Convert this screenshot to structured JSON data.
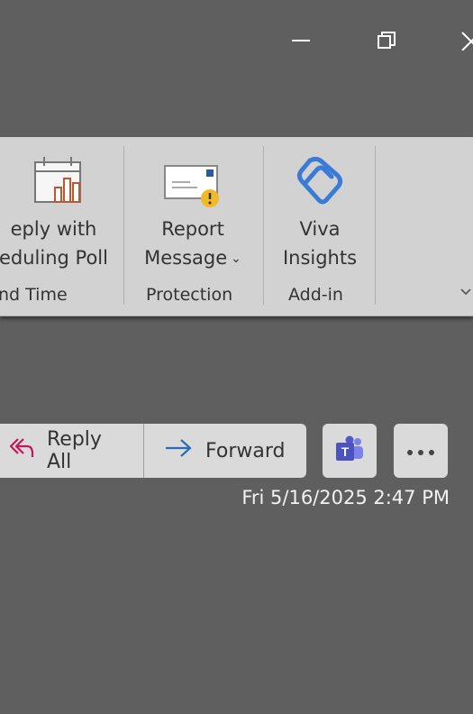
{
  "window": {
    "minimize_icon": "minimize-icon",
    "restore_icon": "restore-icon",
    "close_icon": "close-icon"
  },
  "ribbon": {
    "groups": [
      {
        "label": "nd Time",
        "buttons": [
          {
            "line1": "eply with",
            "line2": "eduling Poll",
            "icon": "scheduling-poll-icon"
          }
        ]
      },
      {
        "label": "Protection",
        "buttons": [
          {
            "line1": "Report",
            "line2": "Message",
            "has_dropdown": true,
            "icon": "report-message-icon"
          }
        ]
      },
      {
        "label": "Add-in",
        "buttons": [
          {
            "line1": "Viva",
            "line2": "Insights",
            "icon": "viva-insights-icon"
          }
        ]
      }
    ],
    "expand_icon": "chevron-down-icon"
  },
  "actions": {
    "reply_all": "Reply All",
    "forward": "Forward",
    "teams_icon": "teams-icon",
    "more_icon": "more-icon"
  },
  "message": {
    "timestamp": "Fri 5/16/2025 2:47 PM"
  },
  "colors": {
    "background": "#5f5f5f",
    "ribbon": "#d2d2d2",
    "button": "#dadada",
    "reply_all_accent": "#c2185b",
    "forward_accent": "#2a6bb7",
    "viva_accent": "#3a7bd5",
    "teams_accent": "#4b53bc"
  }
}
